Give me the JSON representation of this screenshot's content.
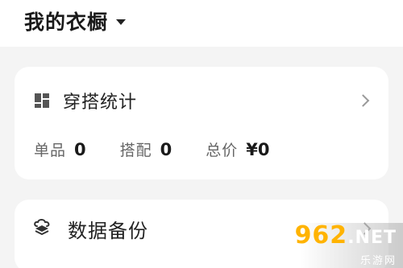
{
  "header": {
    "title": "我的衣橱"
  },
  "stats_card": {
    "title": "穿搭统计",
    "icon": "grid-icon",
    "items": [
      {
        "label": "单品",
        "value": "0"
      },
      {
        "label": "搭配",
        "value": "0"
      },
      {
        "label": "总价",
        "value": "¥0"
      }
    ]
  },
  "backup_card": {
    "title": "数据备份",
    "icon": "cloud-stack-icon"
  },
  "watermark": {
    "main": "962",
    "suffix": ".NET",
    "sub": "乐游网"
  },
  "colors": {
    "background": "#f4f4f4",
    "card": "#ffffff",
    "watermark_accent": "#ffb300"
  }
}
